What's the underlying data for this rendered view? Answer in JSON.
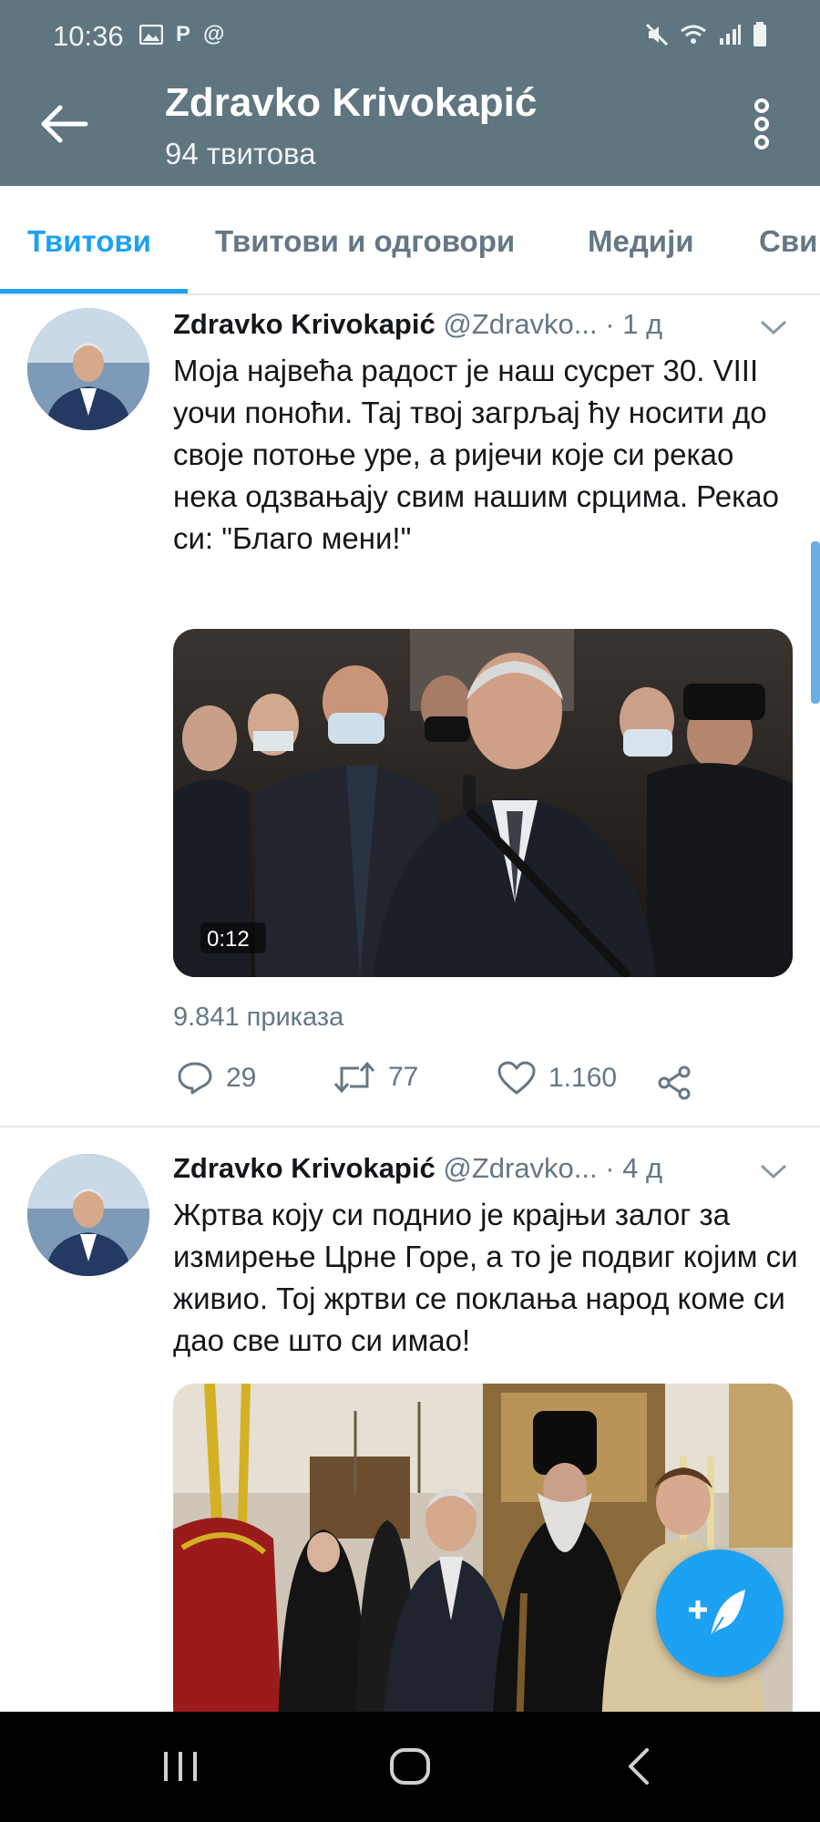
{
  "status_bar": {
    "time": "10:36",
    "left_icons": [
      "gallery-icon",
      "p-icon",
      "at-icon"
    ],
    "right_icons": [
      "mute-icon",
      "wifi-icon",
      "signal-icon",
      "battery-icon"
    ],
    "p_glyph": "P",
    "at_glyph": "@"
  },
  "header": {
    "title": "Zdravko Krivokapić",
    "subtitle": "94 твитова"
  },
  "tabs": [
    {
      "label": "Твитови",
      "active": true
    },
    {
      "label": "Твитови и одговори",
      "active": false
    },
    {
      "label": "Медији",
      "active": false
    },
    {
      "label": "Сви",
      "active": false
    }
  ],
  "colors": {
    "header_bg": "#5f7580",
    "accent": "#1da1f2",
    "secondary_text": "#657786"
  },
  "tweets": [
    {
      "name": "Zdravko Krivokapić",
      "handle": "@Zdravko...",
      "time": "· 1 д",
      "text": "Моја највећа радост је наш сусрет 30. VIII уочи поноћи. Тај твој загрљај ћу носити до своје потоње уре, а ријечи које си рекао нека одзвањају свим нашим срцима. Рекао си: \"Благо мени!\"",
      "video_duration": "0:12",
      "views": "9.841 приказа",
      "replies": "29",
      "retweets": "77",
      "likes": "1.160"
    },
    {
      "name": "Zdravko Krivokapić",
      "handle": "@Zdravko...",
      "time": "· 4 д",
      "text": "Жртва коју си поднио је крајњи залог за измирење Црне Горе, а то је подвиг којим си живио. Тој жртви се поклања народ коме си дао све што си имао!"
    }
  ]
}
